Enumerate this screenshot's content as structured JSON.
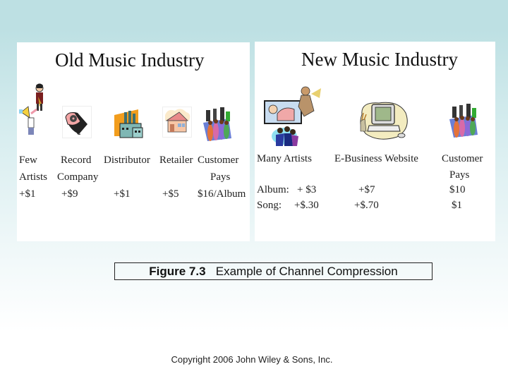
{
  "old_industry": {
    "title": "Old Music Industry",
    "icons": [
      "musician-icon",
      "record-company-icon",
      "factory-icon",
      "retail-store-icon",
      "customers-icon"
    ],
    "columns": [
      {
        "line1": "Few",
        "line2": "Artists",
        "value": "+$1"
      },
      {
        "line1": "Record",
        "line2": "Company",
        "value": "+$9"
      },
      {
        "line1": "Distributor",
        "line2": "",
        "value": "+$1"
      },
      {
        "line1": "Retailer",
        "line2": "",
        "value": "+$5"
      },
      {
        "line1": "Customer",
        "line2": "Pays",
        "value": "$16/Album"
      }
    ]
  },
  "new_industry": {
    "title": "New Music Industry",
    "icons": [
      "artists-icon",
      "computer-icon",
      "customers-icon"
    ],
    "headers": {
      "artists": "Many Artists",
      "website": "E-Business Website",
      "customer_line1": "Customer",
      "customer_line2": "Pays"
    },
    "rows": [
      {
        "label": "Album:",
        "artists": "+ $3",
        "website": "+$7",
        "customer": "$10"
      },
      {
        "label": "Song:",
        "artists": "+$.30",
        "website": "+$.70",
        "customer": "$1"
      }
    ]
  },
  "caption": {
    "figure": "Figure 7.3",
    "text": "Example of Channel Compression"
  },
  "copyright": "Copyright 2006 John Wiley & Sons, Inc."
}
